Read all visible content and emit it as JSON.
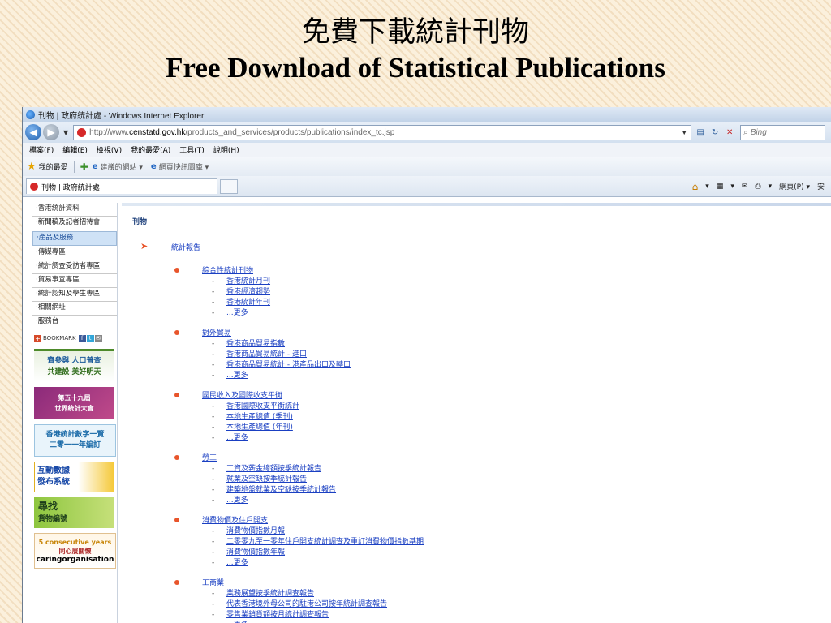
{
  "slide": {
    "title_zh": "免費下載統計刊物",
    "title_en": "Free Download of Statistical Publications"
  },
  "browser": {
    "window_title": "刊物 | 政府統計處 - Windows Internet Explorer",
    "url_prefix": "http://www.",
    "url_host": "censtatd.gov.hk",
    "url_path": "/products_and_services/products/publications/index_tc.jsp",
    "search_placeholder": "Bing",
    "menu": [
      "檔案(F)",
      "編輯(E)",
      "檢視(V)",
      "我的最愛(A)",
      "工具(T)",
      "說明(H)"
    ],
    "favorites_label": "我的最愛",
    "fav_links": [
      "建議的網站 ▾",
      "網頁快訊圖庫 ▾"
    ],
    "tab_title": "刊物 | 政府統計處",
    "commands": [
      "▾",
      "▾",
      "▾",
      "網頁(P) ▾",
      "安"
    ]
  },
  "sidebar": {
    "items": [
      {
        "label": "‧香港統計資料",
        "active": false
      },
      {
        "label": "‧新聞稿及記者招待會",
        "active": false
      },
      {
        "label": "‧產品及服務",
        "active": true
      },
      {
        "label": "‧傳媒專區",
        "active": false
      },
      {
        "label": "‧統計調查受訪者專區",
        "active": false
      },
      {
        "label": "‧貿易事宜專區",
        "active": false
      },
      {
        "label": "‧統計認知及學生專區",
        "active": false
      },
      {
        "label": "‧相關網址",
        "active": false
      },
      {
        "label": "‧服務台",
        "active": false
      }
    ],
    "bookmark_label": "BOOKMARK",
    "banners": {
      "census_l1": "齊參與 人口普查",
      "census_l2": "共建設 美好明天",
      "isi_l1": "第五十九屆",
      "isi_l2": "世界統計大會",
      "figures_l1": "香港統計數字一覽",
      "figures_l2": "二零一一年編訂",
      "interactive_l1": "互動數據",
      "interactive_l2": "發布系統",
      "search_l1": "尋找",
      "search_l2": "貨物編號",
      "caring_l1": "5 consecutive years",
      "caring_l2": "同心展關懷",
      "caring_l3": "caringorganisation"
    }
  },
  "content": {
    "heading": "刊物",
    "lead_link": "統計報告",
    "sections": [
      {
        "title": "綜合性統計刊物",
        "items": [
          "香港統計月刊",
          "香港經濟趨勢",
          "香港統計年刊",
          "...更多"
        ]
      },
      {
        "title": "對外貿易",
        "items": [
          "香港商品貿易指數",
          "香港商品貿易統計 - 進口",
          "香港商品貿易統計 - 港產品出口及轉口",
          "...更多"
        ]
      },
      {
        "title": "國民收入及國際收支平衡",
        "items": [
          "香港國際收支平衡統計",
          "本地生產總值 (季刊)",
          "本地生產總值 (年刊)",
          "...更多"
        ]
      },
      {
        "title": "勞工",
        "items": [
          "工資及薪金總額按季統計報告",
          "就業及空缺按季統計報告",
          "建築地盤就業及空缺按季統計報告",
          "...更多"
        ]
      },
      {
        "title": "消費物價及住戶開支",
        "items": [
          "消費物價指數月報",
          "二零零九至一零年住戶開支統計調查及重訂消費物價指數基期",
          "消費物價指數年報",
          "...更多"
        ]
      },
      {
        "title": "工商業",
        "items": [
          "業務展望按季統計調查報告",
          "代表香港境外母公司的駐港公司按年統計調查報告",
          "零售業銷貨額按月統計調查報告",
          "...更多"
        ]
      }
    ]
  }
}
